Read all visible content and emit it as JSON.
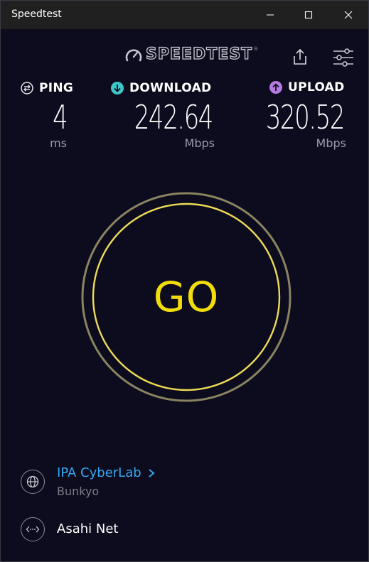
{
  "window": {
    "title": "Speedtest"
  },
  "brand": {
    "logo_text": "SPEEDTEST",
    "trademark": "®"
  },
  "metrics": {
    "ping": {
      "label": "PING",
      "value": "4",
      "unit": "ms"
    },
    "download": {
      "label": "DOWNLOAD",
      "value": "242.64",
      "unit": "Mbps"
    },
    "upload": {
      "label": "UPLOAD",
      "value": "320.52",
      "unit": "Mbps"
    }
  },
  "go_button": {
    "label": "GO"
  },
  "server": {
    "name": "IPA CyberLab",
    "location": "Bunkyo"
  },
  "provider": {
    "name": "Asahi Net"
  },
  "colors": {
    "background": "#0c0c1e",
    "titlebar": "#202020",
    "go_text": "#f2dd0a",
    "server_link": "#3aa7f0",
    "download_icon": "#3ec6c8",
    "upload_icon": "#b57be0"
  },
  "icons": {
    "ping": "ping-icon",
    "download": "download-arrow-icon",
    "upload": "upload-arrow-icon",
    "share": "share-icon",
    "settings": "settings-sliders-icon",
    "server": "globe-icon",
    "provider": "connection-icon"
  }
}
